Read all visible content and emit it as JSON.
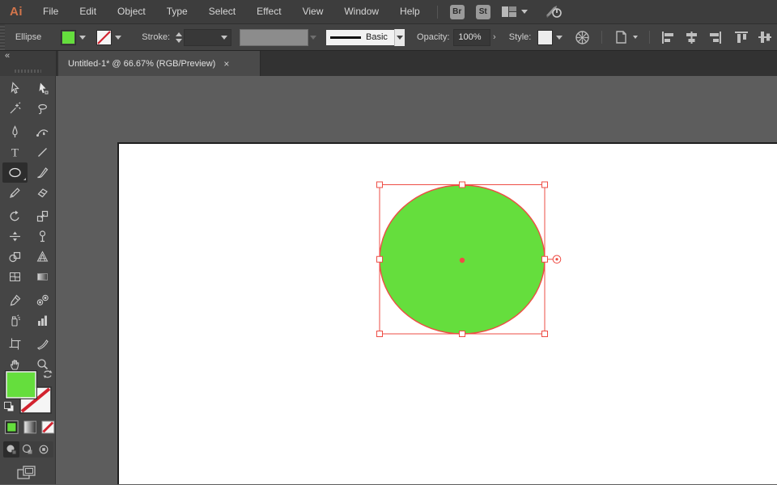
{
  "colors": {
    "fill_green": "#65de3d",
    "selection_red": "#ee4d45",
    "none_red": "#d2232f",
    "logo_orange": "#d3754b",
    "canvas_gray": "#5d5d5d"
  },
  "menubar": {
    "logo": "Ai",
    "items": [
      "File",
      "Edit",
      "Object",
      "Type",
      "Select",
      "Effect",
      "View",
      "Window",
      "Help"
    ],
    "bridge_badge": "Br",
    "stock_badge": "St",
    "icons": [
      "workspace-switcher-icon",
      "gpu-performance-icon"
    ]
  },
  "controlbar": {
    "context_label": "Ellipse",
    "stroke_label": "Stroke:",
    "brush_value": "Basic",
    "opacity_label": "Opacity:",
    "opacity_value": "100%",
    "opacity_menu_glyph": "›",
    "style_label": "Style:",
    "icons": [
      "fill-color-swatch",
      "stroke-color-swatch",
      "width-profile-dropdown",
      "brush-definition-dropdown",
      "style-swatch",
      "recolor-artwork-icon",
      "document-setup-icon",
      "align-left-icon",
      "align-hcenter-icon",
      "align-right-icon",
      "align-top-icon",
      "align-vcenter-icon"
    ]
  },
  "tabbar": {
    "collapse_glyph": "«",
    "tab_title": "Untitled-1* @ 66.67% (RGB/Preview)",
    "close_glyph": "×"
  },
  "toolbar": {
    "type_tool_glyph": "T",
    "selected_tool": "ellipse-tool",
    "tools": [
      "selection-tool",
      "direct-selection-tool",
      "magic-wand-tool",
      "lasso-tool",
      "pen-tool",
      "curvature-tool",
      "type-tool",
      "line-segment-tool",
      "ellipse-tool",
      "paintbrush-tool",
      "shaper-tool",
      "eraser-tool",
      "rotate-tool",
      "scale-tool",
      "width-tool",
      "puppet-warp-tool",
      "shape-builder-tool",
      "perspective-grid-tool",
      "mesh-tool",
      "gradient-tool",
      "eyedropper-tool",
      "blend-tool",
      "symbol-sprayer-tool",
      "column-graph-tool",
      "artboard-tool",
      "slice-tool",
      "hand-tool",
      "zoom-tool"
    ],
    "bottom_controls": [
      "fill-swatch",
      "stroke-swatch",
      "swap-fill-stroke",
      "default-fill-stroke",
      "color-button",
      "gradient-button",
      "none-button",
      "draw-normal-mode",
      "draw-behind-mode",
      "draw-inside-mode",
      "change-screen-mode"
    ]
  },
  "canvas": {
    "artwork": {
      "shape": "ellipse",
      "fill": "#65de3d",
      "selected": true,
      "selection_handles": 8,
      "has_center_point": true,
      "has_pie_widget": true
    }
  }
}
